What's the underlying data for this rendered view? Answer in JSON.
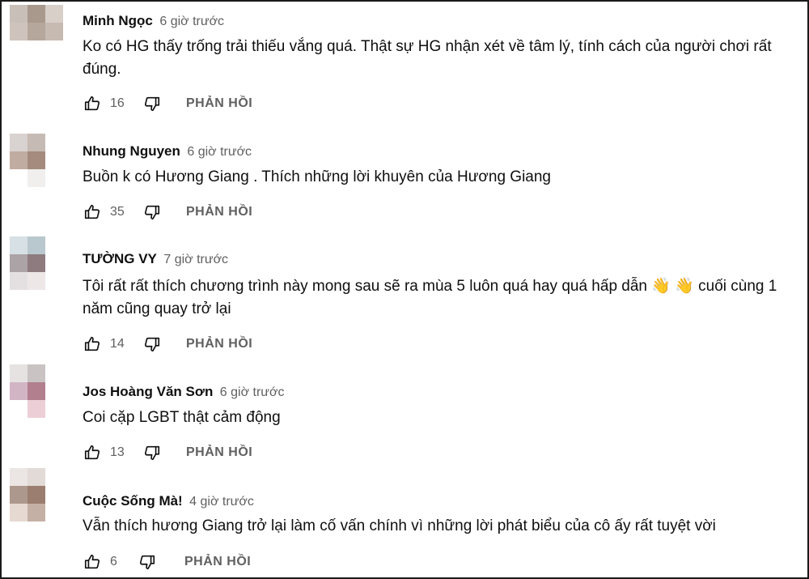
{
  "reply_label": "PHẢN HỒI",
  "comments": [
    {
      "author": "Minh Ngọc",
      "time": "6 giờ trước",
      "text": "Ko có HG thấy trống trải thiếu vắng quá. Thật sự HG nhận xét về tâm lý, tính cách của người chơi rất đúng.",
      "likes": "16",
      "avatar_colors": [
        "#c9bfb9",
        "#a9998d",
        "#d8cfc9",
        "#cfc4bd",
        "#b6a79c",
        "#c7bab1",
        "#ffffff",
        "#ffffff",
        "#ffffff"
      ]
    },
    {
      "author": "Nhung Nguyen",
      "time": "6 giờ trước",
      "text": "Buồn k có Hương Giang . Thích những lời khuyên của Hương Giang",
      "likes": "35",
      "avatar_colors": [
        "#d8d2d0",
        "#c6bab4",
        "#ffffff",
        "#c1aca2",
        "#a48b7d",
        "#ffffff",
        "#ffffff",
        "#f1efee",
        "#ffffff"
      ]
    },
    {
      "author": "TƯỜNG VY",
      "time": "7 giờ trước",
      "text": "Tôi rất rất thích chương trình này mong sau sẽ ra mùa 5 luôn quá hay quá hấp dẫn 👋 👋 cuối cùng 1 năm cũng quay trở lại",
      "likes": "14",
      "avatar_colors": [
        "#d7e0e4",
        "#b9c8ce",
        "#ffffff",
        "#aca3a6",
        "#8d7b7f",
        "#ffffff",
        "#e4e0e1",
        "#ede7e8",
        "#ffffff"
      ]
    },
    {
      "author": "Jos Hoàng Văn Sơn",
      "time": "6 giờ trước",
      "text": "Coi cặp LGBT thật cảm động",
      "likes": "13",
      "avatar_colors": [
        "#e6e2e2",
        "#c9c3c4",
        "#ffffff",
        "#d2b5c4",
        "#b27f8e",
        "#ffffff",
        "#ffffff",
        "#eccfd6",
        "#ffffff"
      ]
    },
    {
      "author": "Cuộc Sống Mà!",
      "time": "4 giờ trước",
      "text": "Vẫn thích hương Giang trở lại làm cố vấn chính vì những lời phát biểu của cô ấy rất tuyệt vời",
      "likes": "6",
      "avatar_colors": [
        "#ebe6e4",
        "#e1dad6",
        "#ffffff",
        "#ad988e",
        "#9b7e6f",
        "#ffffff",
        "#e6d9d2",
        "#c5b0a5",
        "#ffffff"
      ]
    }
  ]
}
